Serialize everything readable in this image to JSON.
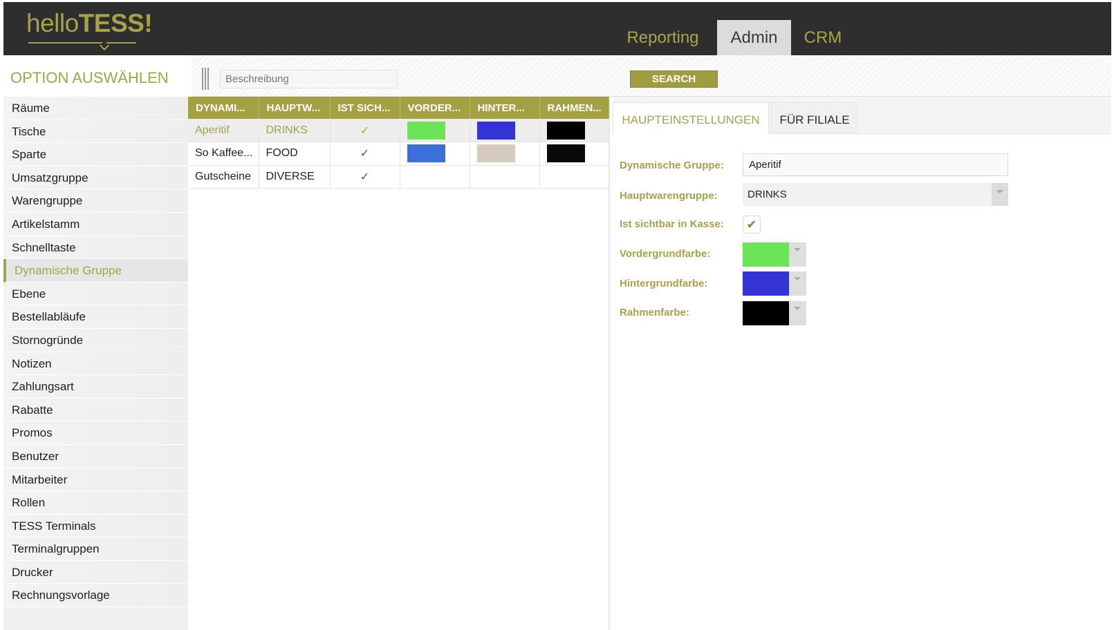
{
  "app": {
    "logo_light": "hello",
    "logo_bold": "TESS!"
  },
  "nav": {
    "tabs": [
      {
        "label": "Reporting"
      },
      {
        "label": "Admin"
      },
      {
        "label": "CRM"
      }
    ],
    "active": "Admin"
  },
  "toolbar": {
    "title": "OPTION AUSWÄHLEN",
    "search_placeholder": "Beschreibung",
    "search_label": "SEARCH"
  },
  "sidebar": {
    "items": [
      {
        "label": "Räume"
      },
      {
        "label": "Tische"
      },
      {
        "label": "Sparte"
      },
      {
        "label": "Umsatzgruppe"
      },
      {
        "label": "Warengruppe"
      },
      {
        "label": "Artikelstamm"
      },
      {
        "label": "Schnelltaste"
      },
      {
        "label": "Dynamische Gruppe"
      },
      {
        "label": "Ebene"
      },
      {
        "label": "Bestellabläufe"
      },
      {
        "label": "Stornogründe"
      },
      {
        "label": "Notizen"
      },
      {
        "label": "Zahlungsart"
      },
      {
        "label": "Rabatte"
      },
      {
        "label": "Promos"
      },
      {
        "label": "Benutzer"
      },
      {
        "label": "Mitarbeiter"
      },
      {
        "label": "Rollen"
      },
      {
        "label": "TESS Terminals"
      },
      {
        "label": "Terminalgruppen"
      },
      {
        "label": "Drucker"
      },
      {
        "label": "Rechnungsvorlage"
      }
    ],
    "active": "Dynamische Gruppe"
  },
  "grid": {
    "columns": [
      "DYNAMI...",
      "HAUPTW...",
      "IST SICH...",
      "VORDER...",
      "HINTER...",
      "RAHMEN..."
    ],
    "rows": [
      {
        "name": "Aperitif",
        "group": "DRINKS",
        "visible": "✓",
        "fg": "#6ce45a",
        "bg": "#3434d4",
        "border": "#000000",
        "selected": true
      },
      {
        "name": "So Kaffee...",
        "group": "FOOD",
        "visible": "✓",
        "fg": "#3c6fd8",
        "bg": "#d6cbbf",
        "border": "#0a0a0a",
        "selected": false
      },
      {
        "name": "Gutscheine",
        "group": "DIVERSE",
        "visible": "✓",
        "fg": "",
        "bg": "",
        "border": "",
        "selected": false
      }
    ]
  },
  "panel": {
    "tabs": [
      {
        "label": "HAUPTEINSTELLUNGEN"
      },
      {
        "label": "FÜR FILIALE"
      }
    ],
    "fields": {
      "dyn_group_label": "Dynamische Gruppe:",
      "dyn_group_value": "Aperitif",
      "main_group_label": "Hauptwarengruppe:",
      "main_group_value": "DRINKS",
      "visible_label": "Ist sichtbar in Kasse:",
      "visible_check": "✔",
      "fg_label": "Vordergrundfarbe:",
      "fg_color": "#6ce45a",
      "bg_label": "Hintergrundfarbe:",
      "bg_color": "#3434d4",
      "border_label": "Rahmenfarbe:",
      "border_color": "#000000"
    }
  },
  "colors": {
    "accent": "#a5a24a",
    "header_bg": "#2e2e2e"
  }
}
